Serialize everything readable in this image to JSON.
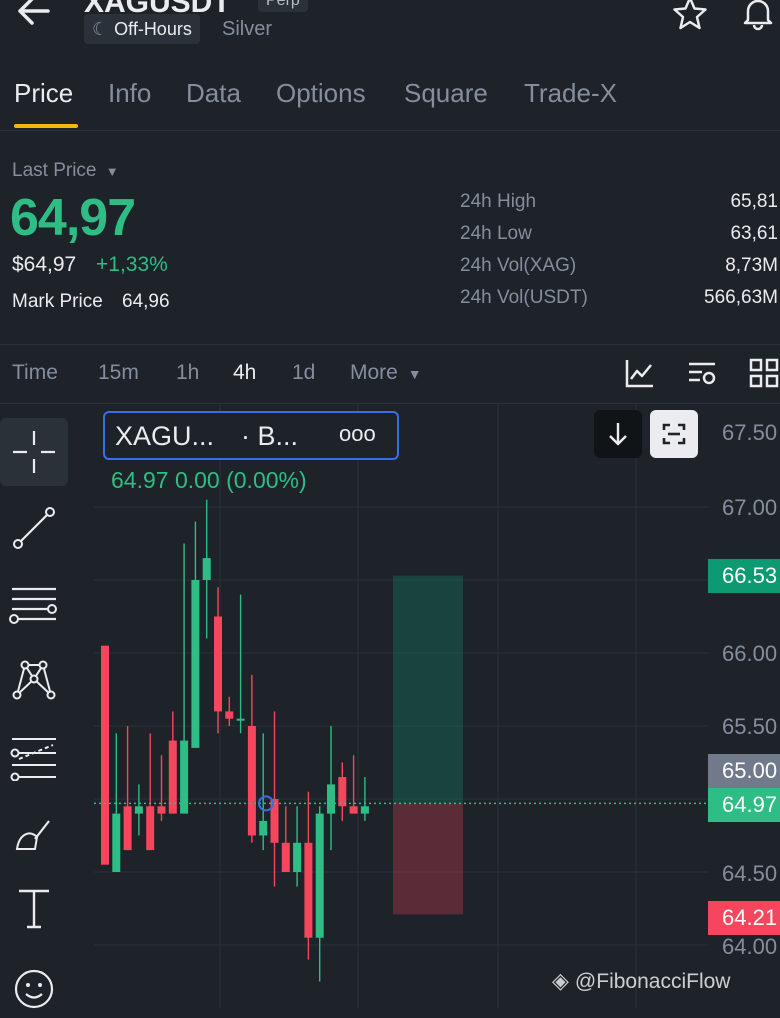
{
  "header": {
    "symbol": "XAGUSDT",
    "perp_badge": "Perp",
    "status": "Off-Hours",
    "asset_name": "Silver"
  },
  "tabs": [
    {
      "label": "Price",
      "active": true
    },
    {
      "label": "Info"
    },
    {
      "label": "Data"
    },
    {
      "label": "Options"
    },
    {
      "label": "Square"
    },
    {
      "label": "Trade-X"
    }
  ],
  "price": {
    "last_price_label": "Last Price",
    "last_price": "64,97",
    "usd_price": "$64,97",
    "change": "+1,33%",
    "mark_label": "Mark Price",
    "mark_value": "64,96"
  },
  "stats": [
    {
      "label": "24h High",
      "value": "65,81"
    },
    {
      "label": "24h Low",
      "value": "63,61"
    },
    {
      "label": "24h Vol(XAG)",
      "value": "8,73M"
    },
    {
      "label": "24h Vol(USDT)",
      "value": "566,63M"
    }
  ],
  "timeframes": {
    "items": [
      "Time",
      "15m",
      "1h",
      "4h",
      "1d"
    ],
    "active": "4h",
    "more_label": "More"
  },
  "chart": {
    "legend_name": "XAGU...",
    "legend_exchange": "· B...",
    "legend_more": "ooo",
    "legend_stats": "64.97  0.00 (0.00%)",
    "y_ticks": [
      "67.50",
      "67.00",
      "66.00",
      "65.50",
      "64.50",
      "64.00"
    ],
    "tags": [
      {
        "value": "66.53",
        "color": "#0c9a72"
      },
      {
        "value": "65.00",
        "color": "#707a8a"
      },
      {
        "value": "64.97",
        "color": "#2ebd85"
      },
      {
        "value": "64.21",
        "color": "#f6465d"
      }
    ],
    "up_color": "#2ebd85",
    "down_color": "#f6465d"
  },
  "watermark": "@FibonacciFlow"
}
